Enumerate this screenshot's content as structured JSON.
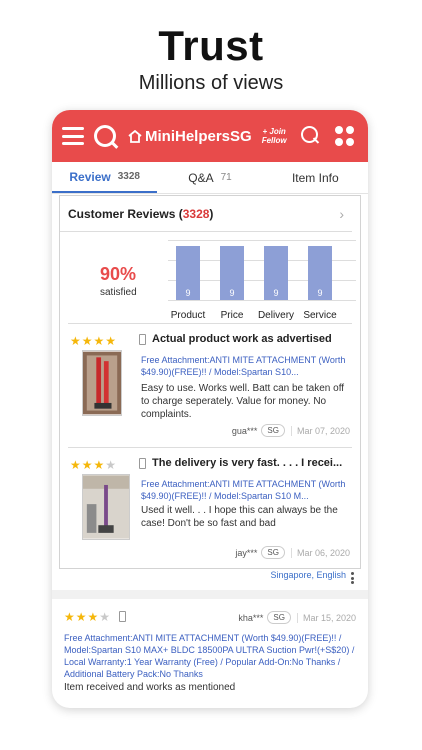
{
  "hero": {
    "title": "Trust",
    "subtitle": "Millions of views"
  },
  "header": {
    "shop_name": "MiniHelpersSG",
    "join_line1": "+ Join",
    "join_line2": "Fellow"
  },
  "tabs": [
    {
      "label": "Review",
      "count": "3328"
    },
    {
      "label": "Q&A",
      "count": "71"
    },
    {
      "label": "Item Info",
      "count": ""
    }
  ],
  "summary": {
    "title": "Customer Reviews",
    "count_open": " (",
    "count": "3328",
    "count_close": ")",
    "percent": "90%",
    "percent_label": "satisfied"
  },
  "chart_data": {
    "type": "bar",
    "categories": [
      "Product",
      "Price",
      "Delivery",
      "Service"
    ],
    "values": [
      9,
      9,
      9,
      9
    ],
    "title": "",
    "xlabel": "",
    "ylabel": "",
    "ylim": [
      0,
      10
    ],
    "bar_color": "#8d9fd6"
  },
  "reviews": [
    {
      "rating": 4,
      "title": "Actual product work as advertised",
      "attachment": "Free Attachment:ANTI MITE ATTACHMENT (Worth $49.90)(FREE)!! / Model:Spartan S10...",
      "body": "Easy to use. Works well. Batt can be taken off to charge seperately. Value for money. No complaints.",
      "user": "gua***",
      "country": "SG",
      "date": "Mar 07, 2020"
    },
    {
      "rating": 3,
      "title": "The delivery is very fast. . . . I recei...",
      "attachment": "Free Attachment:ANTI MITE ATTACHMENT (Worth $49.90)(FREE)!! / Model:Spartan S10 M...",
      "body": "Used it well. . . I hope this can always be the case! Don't be so fast and bad",
      "user": "jay***",
      "country": "SG",
      "date": "Mar 06, 2020"
    }
  ],
  "language_label": "Singapore, English",
  "review3": {
    "rating": 3,
    "user": "kha***",
    "country": "SG",
    "date": "Mar 15, 2020",
    "attachment": "Free Attachment:ANTI MITE ATTACHMENT (Worth $49.90)(FREE)!! / Model:Spartan S10 MAX+ BLDC 18500PA ULTRA Suction Pwr!(+S$20) / Local Warranty:1 Year Warranty (Free) / Popular Add-On:No Thanks / Additional Battery Pack:No Thanks",
    "body": "Item received and works as mentioned"
  },
  "colors": {
    "brand": "#e84b4b",
    "accent": "#3b6fc9",
    "star": "#f5b70b"
  }
}
